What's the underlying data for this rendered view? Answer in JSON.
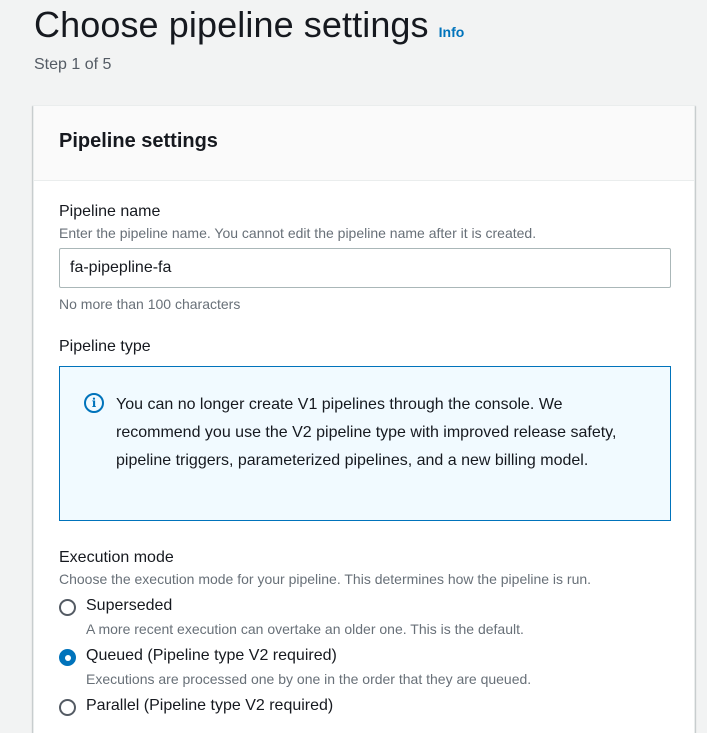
{
  "header": {
    "title": "Choose pipeline settings",
    "info_link": "Info",
    "step": "Step 1 of 5"
  },
  "panel": {
    "title": "Pipeline settings",
    "pipeline_name": {
      "label": "Pipeline name",
      "description": "Enter the pipeline name. You cannot edit the pipeline name after it is created.",
      "value": "fa-pipepline-fa",
      "constraint": "No more than 100 characters"
    },
    "pipeline_type": {
      "label": "Pipeline type",
      "alert_text": "You can no longer create V1 pipelines through the console. We recommend you use the V2 pipeline type with improved release safety, pipeline triggers, parameterized pipelines, and a new billing model."
    },
    "execution_mode": {
      "label": "Execution mode",
      "description": "Choose the execution mode for your pipeline. This determines how the pipeline is run.",
      "options": [
        {
          "label": "Superseded",
          "description": "A more recent execution can overtake an older one. This is the default.",
          "selected": false
        },
        {
          "label": "Queued (Pipeline type V2 required)",
          "description": "Executions are processed one by one in the order that they are queued.",
          "selected": true
        },
        {
          "label": "Parallel (Pipeline type V2 required)",
          "description": "",
          "selected": false
        }
      ]
    }
  },
  "colors": {
    "accent": "#0073bb",
    "alert_bg": "#f1faff",
    "page_bg": "#f2f3f3"
  },
  "icons": {
    "alert": "info-circle-icon"
  }
}
